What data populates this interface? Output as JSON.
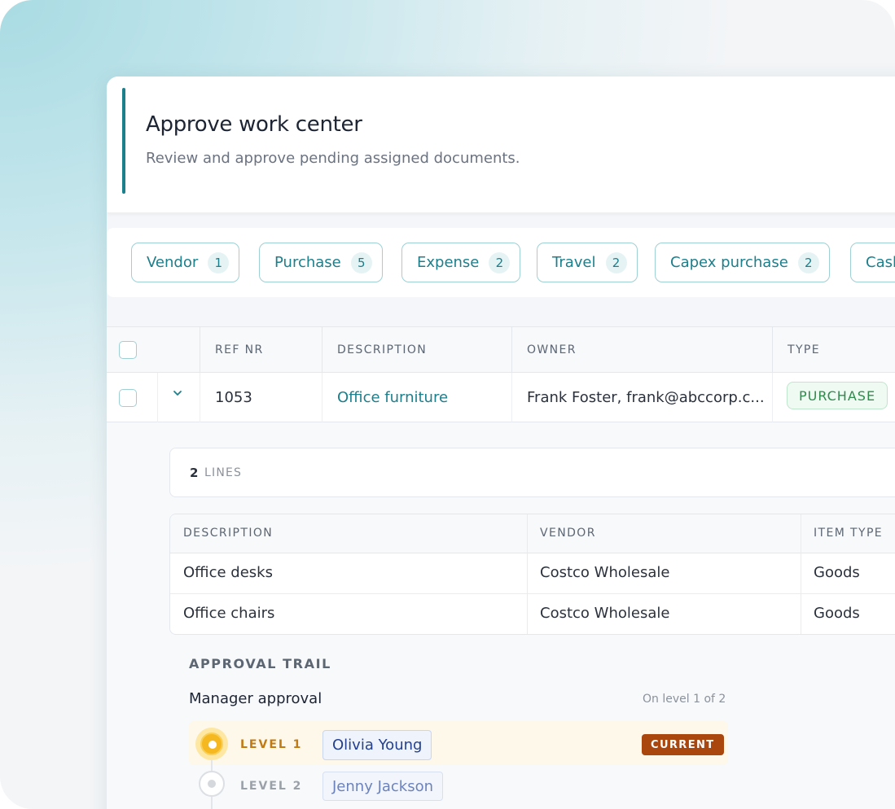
{
  "header": {
    "title": "Approve work center",
    "subtitle": "Review and approve pending assigned documents."
  },
  "filters": [
    {
      "label": "Vendor",
      "count": "1"
    },
    {
      "label": "Purchase",
      "count": "5"
    },
    {
      "label": "Expense",
      "count": "2"
    },
    {
      "label": "Travel",
      "count": "2"
    },
    {
      "label": "Capex purchase",
      "count": "2"
    },
    {
      "label": "Cash",
      "count": ""
    }
  ],
  "table": {
    "columns": [
      "REF NR",
      "DESCRIPTION",
      "OWNER",
      "TYPE"
    ],
    "rows": [
      {
        "ref": "1053",
        "description": "Office furniture",
        "owner": "Frank Foster, frank@abccorp.c...",
        "type": "PURCHASE"
      }
    ]
  },
  "detail": {
    "lines_count": "2",
    "lines_label": "LINES",
    "columns": [
      "DESCRIPTION",
      "VENDOR",
      "ITEM TYPE"
    ],
    "lines": [
      {
        "description": "Office desks",
        "vendor": "Costco Wholesale",
        "item_type": "Goods"
      },
      {
        "description": "Office chairs",
        "vendor": "Costco Wholesale",
        "item_type": "Goods"
      }
    ]
  },
  "approval_trail": {
    "heading": "APPROVAL TRAIL",
    "step": "Manager approval",
    "progress": "On level 1 of 2",
    "levels": [
      {
        "label": "LEVEL 1",
        "approver": "Olivia Young",
        "status": "CURRENT"
      },
      {
        "label": "LEVEL 2",
        "approver": "Jenny Jackson",
        "status": ""
      }
    ]
  },
  "colors": {
    "accent": "#1b7f8c",
    "current_badge": "#a9470f",
    "level_current": "#f5b820",
    "type_badge": "#2f8a4c"
  }
}
